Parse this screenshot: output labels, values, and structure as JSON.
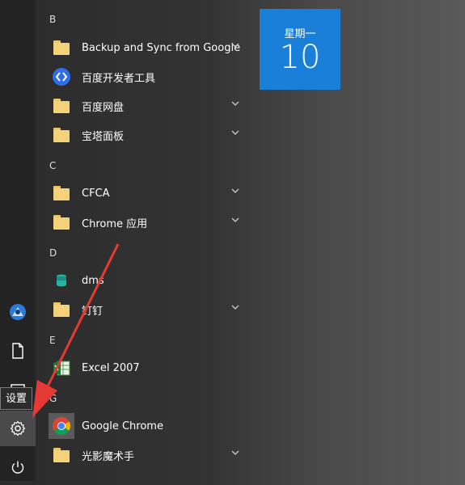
{
  "sections": {
    "b": "B",
    "c": "C",
    "d": "D",
    "e": "E",
    "g": "G"
  },
  "apps": [
    {
      "label": "Backup and Sync from Google",
      "icon": "folder-icon",
      "expandable": true
    },
    {
      "label": "百度开发者工具",
      "icon": "baidu-devtools-icon",
      "expandable": false
    },
    {
      "label": "百度网盘",
      "icon": "folder-icon",
      "expandable": true
    },
    {
      "label": "宝塔面板",
      "icon": "folder-icon",
      "expandable": true
    },
    {
      "label": "CFCA",
      "icon": "folder-icon",
      "expandable": true
    },
    {
      "label": "Chrome 应用",
      "icon": "folder-icon",
      "expandable": true
    },
    {
      "label": "dms",
      "icon": "dms-icon",
      "expandable": false
    },
    {
      "label": "钉钉",
      "icon": "folder-icon",
      "expandable": true
    },
    {
      "label": "Excel 2007",
      "icon": "excel-icon",
      "expandable": false
    },
    {
      "label": "Google Chrome",
      "icon": "chrome-icon",
      "expandable": false
    },
    {
      "label": "光影魔术手",
      "icon": "folder-icon",
      "expandable": true
    }
  ],
  "tile": {
    "day_of_week": "星期一",
    "day": "10",
    "color": "#1a7fd8"
  },
  "rail": {
    "tooltip": "设置",
    "items": [
      "user-avatar-icon",
      "document-icon",
      "pictures-icon",
      "settings-icon",
      "power-icon"
    ]
  },
  "annotation": {
    "arrow_color": "#e53935"
  }
}
